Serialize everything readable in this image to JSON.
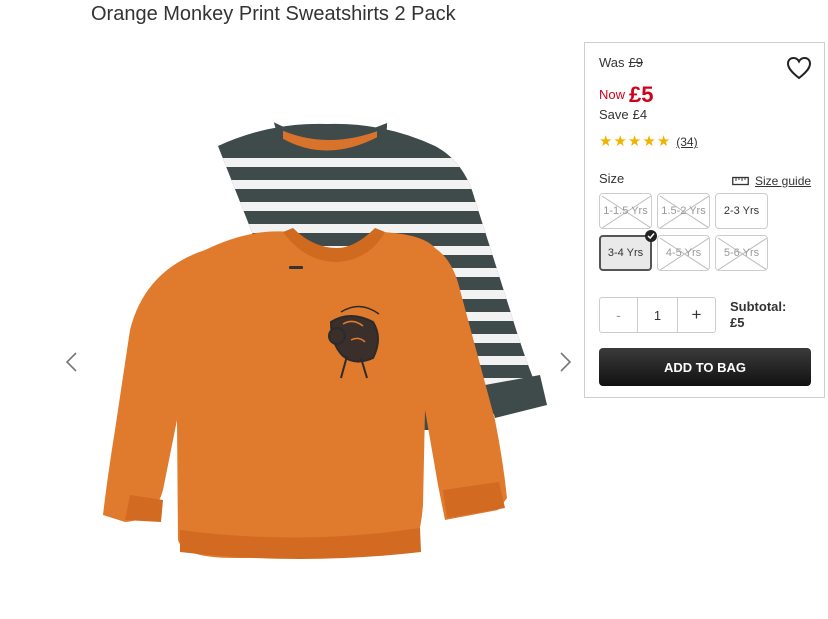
{
  "product": {
    "title": "Orange Monkey Print Sweatshirts 2 Pack"
  },
  "price": {
    "was_label": "Was",
    "was_value": "£9",
    "now_label": "Now",
    "now_value": "£5",
    "save_label": "Save",
    "save_value": "£4"
  },
  "rating": {
    "stars": 5,
    "count": "(34)"
  },
  "size": {
    "label": "Size",
    "guide_label": "Size guide",
    "options": [
      {
        "label": "1-1.5 Yrs",
        "available": false,
        "selected": false
      },
      {
        "label": "1.5-2 Yrs",
        "available": false,
        "selected": false
      },
      {
        "label": "2-3 Yrs",
        "available": true,
        "selected": false
      },
      {
        "label": "3-4 Yrs",
        "available": true,
        "selected": true
      },
      {
        "label": "4-5 Yrs",
        "available": false,
        "selected": false
      },
      {
        "label": "5-6 Yrs",
        "available": false,
        "selected": false
      }
    ]
  },
  "quantity": {
    "minus": "-",
    "value": "1",
    "plus": "+"
  },
  "subtotal": {
    "label": "Subtotal:",
    "value": "£5"
  },
  "add_to_bag": "ADD TO BAG",
  "colors": {
    "price_red": "#d0021b",
    "star": "#f0b400",
    "button": "#1e1e1e"
  },
  "icons": [
    "heart-icon",
    "ruler-icon",
    "chevron-left-icon",
    "chevron-right-icon",
    "check-icon",
    "star-icon"
  ]
}
